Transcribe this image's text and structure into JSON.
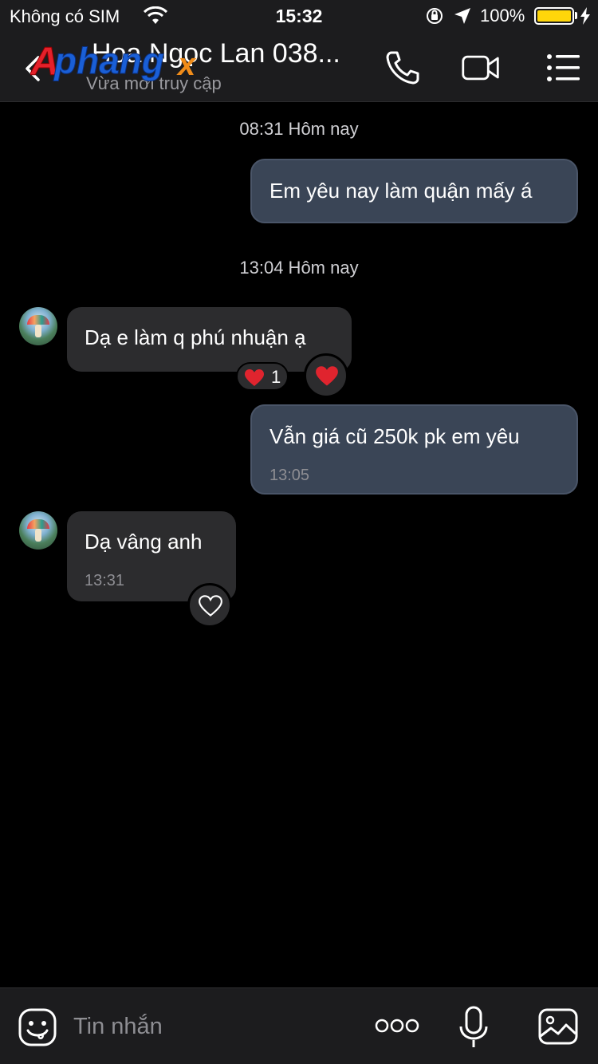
{
  "status_bar": {
    "carrier": "Không có SIM",
    "time": "15:32",
    "battery_percent": "100%",
    "battery_color": "#ffd60a",
    "icons": [
      "wifi-icon",
      "orientation-lock-icon",
      "location-arrow-icon",
      "battery-icon",
      "charging-bolt-icon"
    ]
  },
  "header": {
    "contact_name": "Hoa Ngọc Lan 038...",
    "presence": "Vừa mới truy cập",
    "logo_text": "Aphangx",
    "icons": [
      "back-chevron-icon",
      "phone-icon",
      "video-camera-icon",
      "menu-list-icon"
    ]
  },
  "chat": {
    "accent_outgoing": "#3a4556",
    "accent_incoming": "#2c2c2e",
    "timestamps": [
      "08:31 Hôm nay",
      "13:04 Hôm nay"
    ],
    "messages": [
      {
        "direction": "out",
        "text": "Em yêu nay làm quận mấy á",
        "time": ""
      },
      {
        "direction": "in",
        "text": "Dạ e làm q phú nhuận ạ",
        "time": "",
        "reaction": "heart",
        "reaction_count": "1"
      },
      {
        "direction": "out",
        "text": "Vẫn giá cũ 250k pk em yêu",
        "time": "13:05"
      },
      {
        "direction": "in",
        "text": "Dạ vâng anh",
        "time": "13:31"
      }
    ]
  },
  "input_bar": {
    "placeholder": "Tin nhắn",
    "icons": [
      "emoji-icon",
      "more-dots-icon",
      "microphone-icon",
      "image-icon"
    ]
  }
}
